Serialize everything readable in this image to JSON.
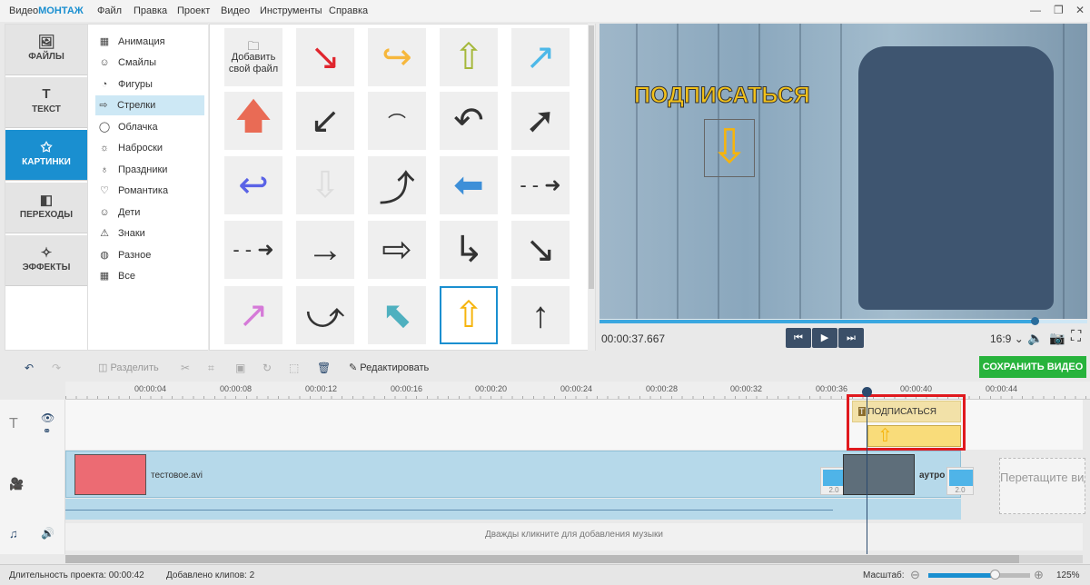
{
  "app": {
    "logo_prefix": "Видео",
    "logo_brand": "МОНТАЖ"
  },
  "menu": [
    "Файл",
    "Правка",
    "Проект",
    "Видео",
    "Инструменты",
    "Справка"
  ],
  "nav": [
    {
      "label": "ФАЙЛЫ",
      "icon": "image-icon"
    },
    {
      "label": "ТЕКСТ",
      "icon": "text-icon"
    },
    {
      "label": "КАРТИНКИ",
      "icon": "star-icon"
    },
    {
      "label": "ПЕРЕХОДЫ",
      "icon": "transitions-icon"
    },
    {
      "label": "ЭФФЕКТЫ",
      "icon": "magic-wand-icon"
    }
  ],
  "categories": [
    "Анимация",
    "Смайлы",
    "Фигуры",
    "Стрелки",
    "Облачка",
    "Наброски",
    "Праздники",
    "Романтика",
    "Дети",
    "Знаки",
    "Разное",
    "Все"
  ],
  "active_category": "Стрелки",
  "grid": {
    "add_file": "Добавить свой файл"
  },
  "preview": {
    "overlay_text": "ПОДПИСАТЬСЯ",
    "timecode": "00:00:37.667",
    "aspect": "16:9",
    "progress": 0.89
  },
  "toolbar": {
    "split": "Разделить",
    "edit": "Редактировать",
    "save": "СОХРАНИТЬ ВИДЕО"
  },
  "ruler": [
    "00:00:04",
    "00:00:08",
    "00:00:12",
    "00:00:16",
    "00:00:20",
    "00:00:24",
    "00:00:28",
    "00:00:32",
    "00:00:36",
    "00:00:40",
    "00:00:44"
  ],
  "timeline": {
    "text_clip": "ПОДПИСАТЬСЯ",
    "video_clip": "тестовое.avi",
    "outro_clip": "аутро",
    "transition1": "2.0",
    "transition2": "2.0",
    "drop_hint": "Перетащите видео и",
    "music_hint": "Дважды кликните для добавления музыки"
  },
  "status": {
    "duration_label": "Длительность проекта:",
    "duration": "00:00:42",
    "clips_label": "Добавлено клипов:",
    "clips": "2",
    "zoom_label": "Масштаб:",
    "zoom": "125%",
    "zoom_value": 0.65
  }
}
